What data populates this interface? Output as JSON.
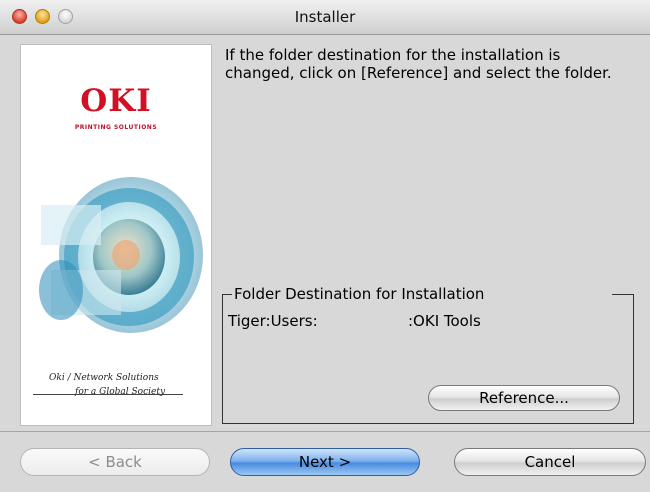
{
  "window": {
    "title": "Installer"
  },
  "sidebar": {
    "logo_text": "OKI",
    "logo_subtext": "PRINTING SOLUTIONS",
    "tagline_line1": "Oki / Network Solutions",
    "tagline_line2": "for a Global Society"
  },
  "main": {
    "description": "If the folder destination for the installation is changed, click on [Reference] and select the folder."
  },
  "destination": {
    "legend": "Folder Destination for Installation",
    "path_left": "Tiger:Users:",
    "path_right": ":OKI Tools",
    "reference_label": "Reference..."
  },
  "footer": {
    "back_label": "< Back",
    "next_label": "Next >",
    "cancel_label": "Cancel"
  }
}
